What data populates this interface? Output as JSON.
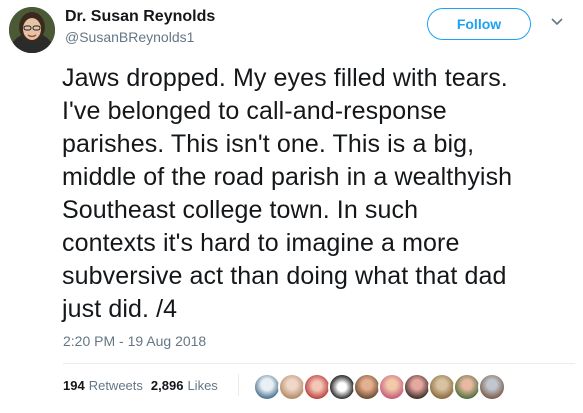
{
  "author": {
    "name": "Dr. Susan Reynolds",
    "handle": "@SusanBReynolds1"
  },
  "follow_label": "Follow",
  "tweet": {
    "text": "Jaws dropped. My eyes filled with tears.\nI've belonged to call-and-response\nparishes. This isn't one. This is a big,\nmiddle of the road parish in a wealthyish\nSoutheast college town. In such\ncontexts it's hard to imagine a more\nsubversive act than doing what that dad\njust did. /4",
    "timestamp": "2:20 PM - 19 Aug 2018"
  },
  "stats": {
    "retweets_count": "194",
    "retweets_label": "Retweets",
    "likes_count": "2,896",
    "likes_label": "Likes"
  },
  "colors": {
    "accent": "#1da1f2",
    "secondary_text": "#657786"
  }
}
